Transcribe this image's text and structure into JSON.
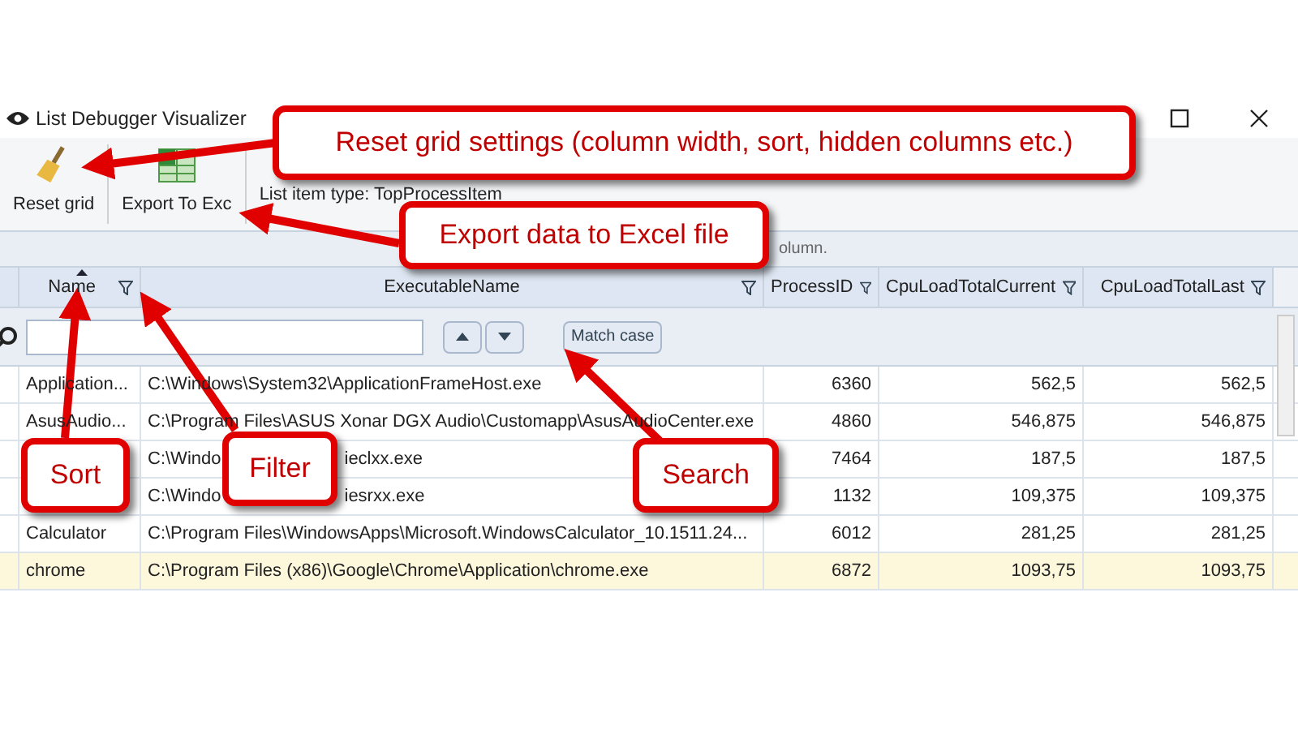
{
  "window": {
    "title": "List Debugger Visualizer"
  },
  "toolbar": {
    "buttons": [
      {
        "label": "Reset grid",
        "kind": "broom"
      },
      {
        "label": "Export To Exc",
        "kind": "excel"
      }
    ],
    "info": "List item type: TopProcessItem"
  },
  "group_panel": {
    "text": "olumn."
  },
  "table": {
    "columns": [
      {
        "label": "Name",
        "sorted": true,
        "filter": true
      },
      {
        "label": "ExecutableName",
        "sorted": false,
        "filter": true
      },
      {
        "label": "ProcessID",
        "sorted": false,
        "filter": true
      },
      {
        "label": "CpuLoadTotalCurrent",
        "sorted": false,
        "filter": true
      },
      {
        "label": "CpuLoadTotalLast",
        "sorted": false,
        "filter": true
      }
    ],
    "search": {
      "match_case": "Match case"
    },
    "rows": [
      {
        "name": "Application...",
        "exe": [
          "C:\\Windows\\System32\\ApplicationFrameHost.exe"
        ],
        "pid": "6360",
        "cur": "562,5",
        "last": "562,5",
        "selected": false
      },
      {
        "name": "AsusAudio...",
        "exe": [
          "C:\\Program Files\\ASUS Xonar DGX Audio\\Customapp\\AsusAudioCenter.exe"
        ],
        "pid": "4860",
        "cur": "546,875",
        "last": "546,875",
        "selected": false
      },
      {
        "exe": [
          "C:\\Windo",
          "ieclxx.exe"
        ],
        "pid": "7464",
        "cur": "187,5",
        "last": "187,5",
        "selected": false
      },
      {
        "exe": [
          "C:\\Windo",
          "iesrxx.exe"
        ],
        "pid": "1132",
        "cur": "109,375",
        "last": "109,375",
        "selected": false
      },
      {
        "name": "Calculator",
        "exe": [
          "C:\\Program Files\\WindowsApps\\Microsoft.WindowsCalculator_10.1511.24..."
        ],
        "pid": "6012",
        "cur": "281,25",
        "last": "281,25",
        "selected": false
      },
      {
        "name": "chrome",
        "exe": [
          "C:\\Program Files (x86)\\Google\\Chrome\\Application\\chrome.exe"
        ],
        "pid": "6872",
        "cur": "1093,75",
        "last": "1093,75",
        "selected": true
      }
    ]
  },
  "callouts": [
    {
      "text": "Reset grid settings (column width, sort, hidden columns etc.)",
      "kind": "reset"
    },
    {
      "text": "Export data to Excel file",
      "kind": "export"
    },
    {
      "text": "Sort",
      "kind": "sort"
    },
    {
      "text": "Filter",
      "kind": "filter"
    },
    {
      "text": "Search",
      "kind": "search"
    }
  ]
}
